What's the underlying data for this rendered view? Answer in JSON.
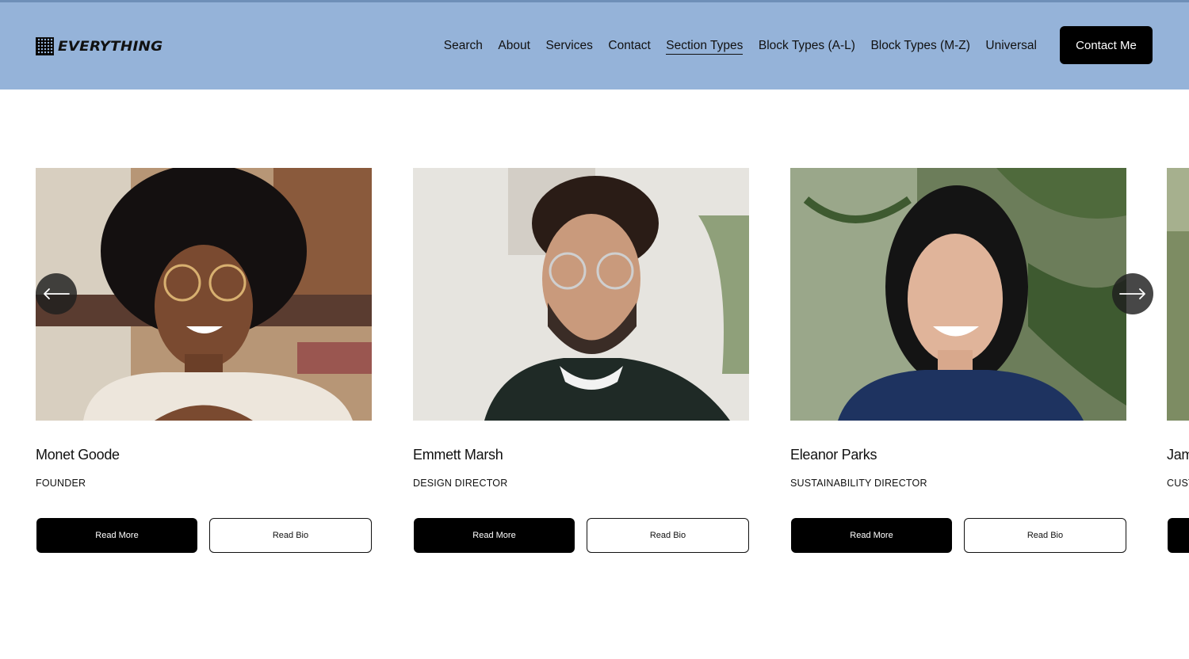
{
  "header": {
    "logo_text": "EVERYTHING",
    "nav": [
      "Search",
      "About",
      "Services",
      "Contact",
      "Section Types",
      "Block Types (A-L)",
      "Block Types (M-Z)",
      "Universal"
    ],
    "active_nav": "Section Types",
    "cta_label": "Contact Me"
  },
  "team": [
    {
      "name": "Monet Goode",
      "role": "FOUNDER",
      "primary_label": "Read More",
      "secondary_label": "Read Bio"
    },
    {
      "name": "Emmett Marsh",
      "role": "DESIGN DIRECTOR",
      "primary_label": "Read More",
      "secondary_label": "Read Bio"
    },
    {
      "name": "Eleanor Parks",
      "role": "SUSTAINABILITY DIRECTOR",
      "primary_label": "Read More",
      "secondary_label": "Read Bio"
    },
    {
      "name": "Jam",
      "role": "CUST",
      "primary_label": "",
      "secondary_label": ""
    }
  ],
  "carousel": {
    "prev_icon": "arrow-left-icon",
    "next_icon": "arrow-right-icon"
  },
  "colors": {
    "header_bg": "#95b3d9",
    "button_primary": "#000000",
    "text": "#111111"
  }
}
